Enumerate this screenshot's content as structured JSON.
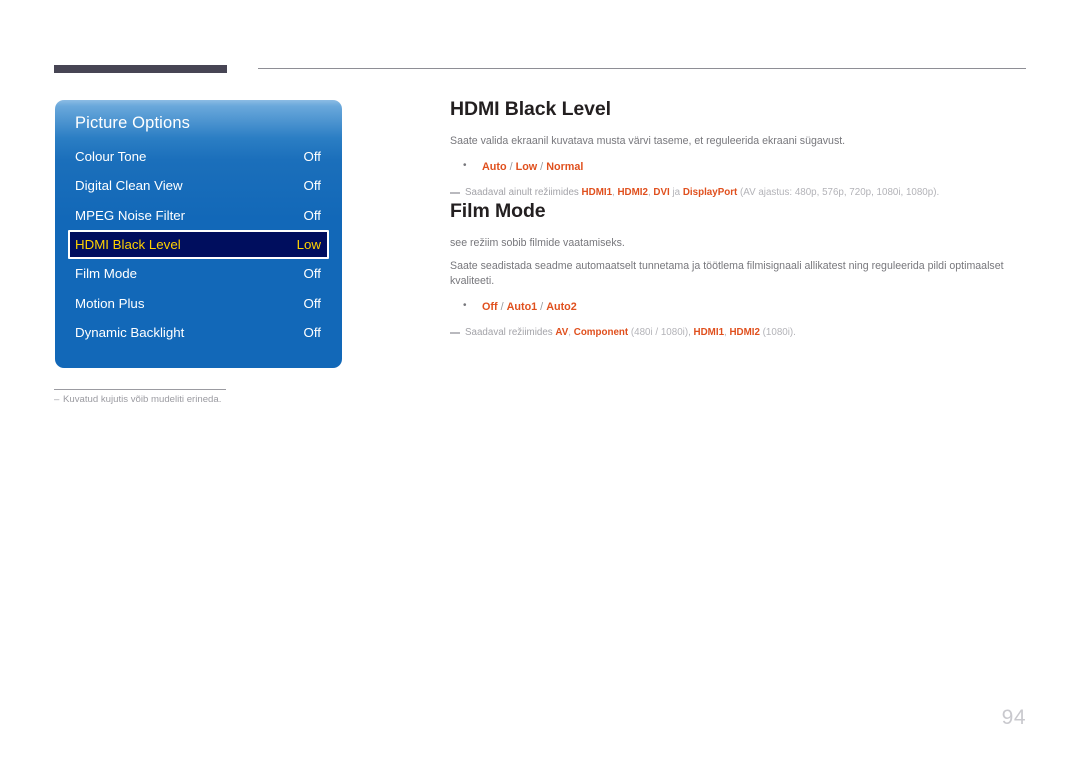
{
  "page": {
    "number": "94",
    "background": "#ffffff"
  },
  "header": {
    "bar_color": "#474554",
    "rule_color": "#8e8e95"
  },
  "osd": {
    "title": "Picture Options",
    "panel_color": "#1268b8",
    "highlight_bg": "#000e5e",
    "highlight_text": "#ffd200",
    "rows": [
      {
        "label": "Colour Tone",
        "value": "Off",
        "selected": false
      },
      {
        "label": "Digital Clean View",
        "value": "Off",
        "selected": false
      },
      {
        "label": "MPEG Noise Filter",
        "value": "Off",
        "selected": false
      },
      {
        "label": "HDMI Black Level",
        "value": "Low",
        "selected": true
      },
      {
        "label": "Film Mode",
        "value": "Off",
        "selected": false
      },
      {
        "label": "Motion Plus",
        "value": "Off",
        "selected": false
      },
      {
        "label": "Dynamic Backlight",
        "value": "Off",
        "selected": false
      }
    ],
    "footnote_dash": "–",
    "footnote": "Kuvatud kujutis võib mudeliti erineda."
  },
  "sections": [
    {
      "title": "HDMI Black Level",
      "paragraphs": [
        "Saate valida ekraanil kuvatava musta värvi taseme, et reguleerida ekraani sügavust."
      ],
      "options": {
        "items": [
          "Auto",
          "Low",
          "Normal"
        ],
        "separator": " / "
      },
      "note": {
        "lead": "Saadaval ainult režiimides ",
        "tokens": [
          "HDMI1",
          "HDMI2",
          "DVI"
        ],
        "conjunction": " ja ",
        "last_token": "DisplayPort",
        "trailing": " (AV ajastus: 480p, 576p, 720p, 1080i, 1080p)."
      }
    },
    {
      "title": "Film Mode",
      "paragraphs": [
        "see režiim sobib filmide vaatamiseks.",
        "Saate seadistada seadme automaatselt tunnetama ja töötlema filmisignaali allikatest ning reguleerida pildi optimaalset kvaliteeti."
      ],
      "options": {
        "items": [
          "Off",
          "Auto1",
          "Auto2"
        ],
        "separator": " / "
      },
      "note": {
        "lead": "Saadaval režiimides ",
        "t1": "AV",
        "s1": ", ",
        "t2": "Component",
        "d1": " (480i / 1080i), ",
        "t3": "HDMI1",
        "s2": ", ",
        "t4": "HDMI2",
        "d2": " (1080i)."
      }
    }
  ]
}
